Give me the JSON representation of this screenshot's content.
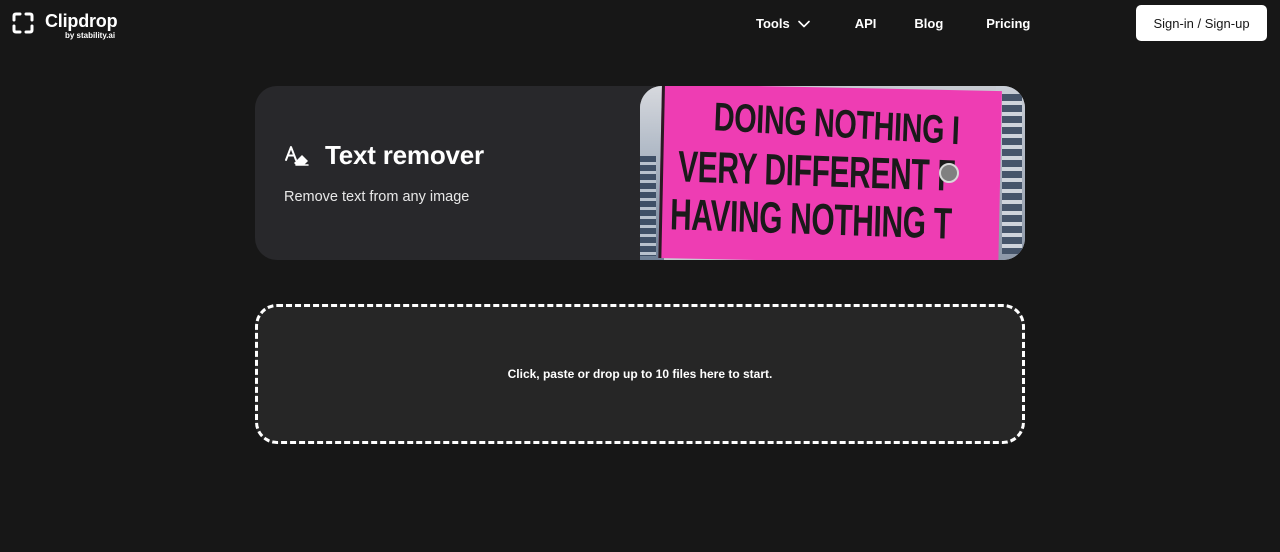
{
  "header": {
    "logo": {
      "name": "Clipdrop",
      "byline": "by stability.ai",
      "icon": "bracket-frame-icon"
    },
    "nav": {
      "tools_label": "Tools",
      "tools_icon": "chevron-down-icon",
      "api_label": "API",
      "blog_label": "Blog",
      "pricing_label": "Pricing"
    },
    "signin_label": "Sign-in / Sign-up"
  },
  "hero": {
    "icon": "eraser-text-icon",
    "title": "Text remover",
    "subtitle": "Remove text from any image",
    "image": {
      "billboard_lines": [
        "DOING NOTHING I",
        "VERY DIFFERENT F",
        "HAVING NOTHING T"
      ],
      "billboard_color": "#ee3db3"
    }
  },
  "dropzone": {
    "text": "Click, paste or drop up to 10 files here to start."
  },
  "colors": {
    "background": "#171717",
    "card": "#28282b",
    "dropzone": "#262626",
    "button_bg": "#ffffff"
  }
}
